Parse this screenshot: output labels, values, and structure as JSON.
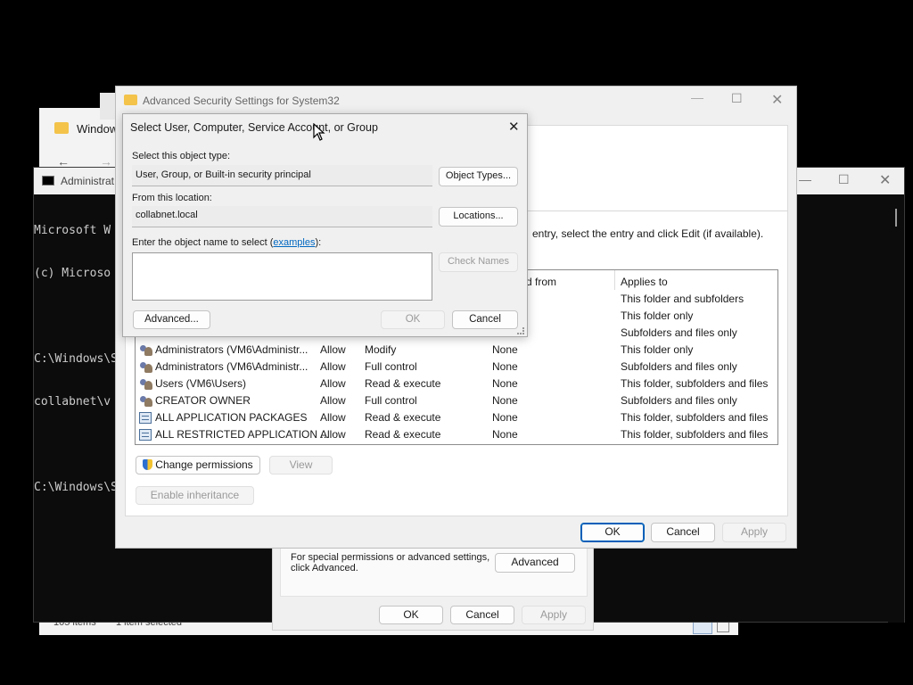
{
  "explorer": {
    "title": "Window",
    "status_items": "105 items",
    "status_selected": "1 item selected"
  },
  "cmd": {
    "title": "Administrat",
    "lines": [
      "Microsoft W",
      "(c) Microso",
      "",
      "C:\\Windows\\S",
      "collabnet\\v",
      "",
      "C:\\Windows\\S"
    ]
  },
  "props": {
    "special_text": "For special permissions or advanced settings, click Advanced.",
    "advanced_label": "Advanced",
    "ok_label": "OK",
    "cancel_label": "Cancel",
    "apply_label": "Apply"
  },
  "adv": {
    "title": "Advanced Security Settings for System32",
    "instruction": "entry, select the entry and click Edit (if available).",
    "columns": {
      "inherited": "d from",
      "applies": "Applies to"
    },
    "rows": [
      {
        "icon": "users",
        "principal": "",
        "access": "",
        "perm": "",
        "inh": "",
        "applies": "This folder and subfolders"
      },
      {
        "icon": "users",
        "principal": "",
        "access": "",
        "perm": "",
        "inh": "",
        "applies": "This folder only"
      },
      {
        "icon": "users",
        "principal": "",
        "access": "",
        "perm": "",
        "inh": "",
        "applies": "Subfolders and files only"
      },
      {
        "icon": "users",
        "principal": "Administrators (VM6\\Administr...",
        "access": "Allow",
        "perm": "Modify",
        "inh": "None",
        "applies": "This folder only"
      },
      {
        "icon": "users",
        "principal": "Administrators (VM6\\Administr...",
        "access": "Allow",
        "perm": "Full control",
        "inh": "None",
        "applies": "Subfolders and files only"
      },
      {
        "icon": "users",
        "principal": "Users (VM6\\Users)",
        "access": "Allow",
        "perm": "Read & execute",
        "inh": "None",
        "applies": "This folder, subfolders and files"
      },
      {
        "icon": "users",
        "principal": "CREATOR OWNER",
        "access": "Allow",
        "perm": "Full control",
        "inh": "None",
        "applies": "Subfolders and files only"
      },
      {
        "icon": "package",
        "principal": "ALL APPLICATION PACKAGES",
        "access": "Allow",
        "perm": "Read & execute",
        "inh": "None",
        "applies": "This folder, subfolders and files"
      },
      {
        "icon": "package",
        "principal": "ALL RESTRICTED APPLICATION ...",
        "access": "Allow",
        "perm": "Read & execute",
        "inh": "None",
        "applies": "This folder, subfolders and files"
      }
    ],
    "change_permissions_label": "Change permissions",
    "view_label": "View",
    "enable_inheritance_label": "Enable inheritance",
    "ok_label": "OK",
    "cancel_label": "Cancel",
    "apply_label": "Apply"
  },
  "select": {
    "title": "Select User, Computer, Service Account, or Group",
    "object_type_caption": "Select this object type:",
    "object_type_value": "User, Group, or Built-in security principal",
    "object_types_button": "Object Types...",
    "location_caption": "From this location:",
    "location_value": "collabnet.local",
    "locations_button": "Locations...",
    "enter_caption": "Enter the object name to select (",
    "examples_link": "examples",
    "enter_caption_end": "):",
    "name_input_value": "",
    "check_names_button": "Check Names",
    "advanced_button": "Advanced...",
    "ok_button": "OK",
    "cancel_button": "Cancel"
  },
  "colors": {
    "accent": "#005fb8",
    "link": "#0067c0",
    "folder": "#f3c34a"
  }
}
